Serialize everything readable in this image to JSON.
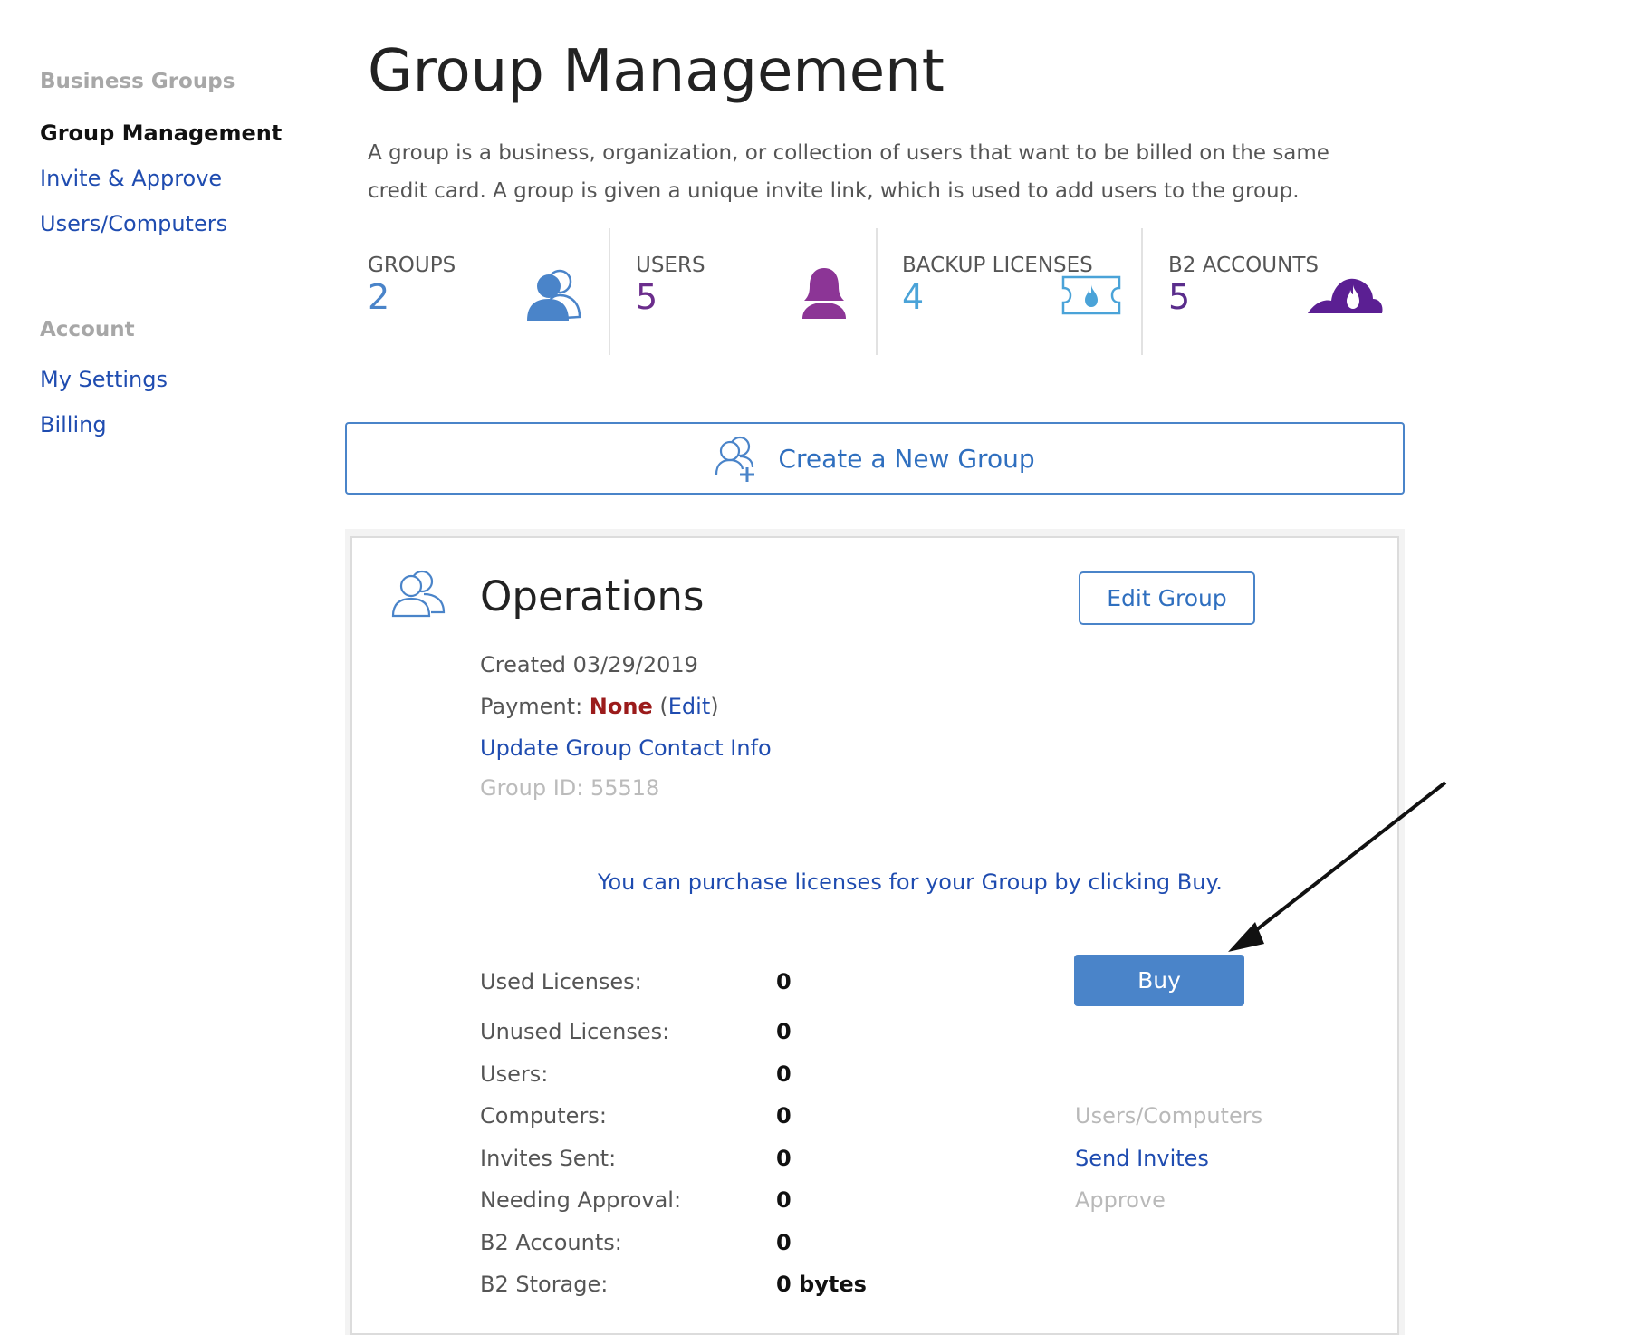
{
  "sidebar": {
    "section1_heading": "Business Groups",
    "items1": [
      "Group Management",
      "Invite & Approve",
      "Users/Computers"
    ],
    "section2_heading": "Account",
    "items2": [
      "My Settings",
      "Billing"
    ]
  },
  "page": {
    "title": "Group Management",
    "description": "A group is a business, organization, or collection of users that want to be billed on the same credit card. A group is given a unique invite link, which is used to add users to the group."
  },
  "stats": [
    {
      "label": "GROUPS",
      "value": "2",
      "color": "#4a84c9",
      "icon": "groups-icon"
    },
    {
      "label": "USERS",
      "value": "5",
      "color": "#6b2d8c",
      "icon": "user-icon"
    },
    {
      "label": "BACKUP LICENSES",
      "value": "4",
      "color": "#4aa3d8",
      "icon": "license-ticket-icon"
    },
    {
      "label": "B2 ACCOUNTS",
      "value": "5",
      "color": "#5a2d8c",
      "icon": "b2-cloud-icon"
    }
  ],
  "create_button": {
    "label": "Create a New Group"
  },
  "group": {
    "name": "Operations",
    "edit_label": "Edit Group",
    "created": "Created 03/29/2019",
    "payment_label": "Payment:",
    "payment_value": "None",
    "payment_edit": "Edit",
    "update_contact": "Update Group Contact Info",
    "group_id": "Group ID: 55518",
    "buy_message": "You can purchase licenses for your Group by clicking Buy.",
    "buy_label": "Buy",
    "rows": [
      {
        "label": "Used Licenses:",
        "value": "0"
      },
      {
        "label": "Unused Licenses:",
        "value": "0"
      },
      {
        "label": "Users:",
        "value": "0"
      },
      {
        "label": "Computers:",
        "value": "0",
        "action": "Users/Computers",
        "action_enabled": false
      },
      {
        "label": "Invites Sent:",
        "value": "0",
        "action": "Send Invites",
        "action_enabled": true
      },
      {
        "label": "Needing Approval:",
        "value": "0",
        "action": "Approve",
        "action_enabled": false
      },
      {
        "label": "B2 Accounts:",
        "value": "0"
      },
      {
        "label": "B2 Storage:",
        "value": "0 bytes"
      }
    ]
  },
  "colors": {
    "link": "#1f4cb0",
    "accent": "#4a84c9",
    "purple": "#6b2d8c",
    "danger": "#9b1b1b"
  }
}
